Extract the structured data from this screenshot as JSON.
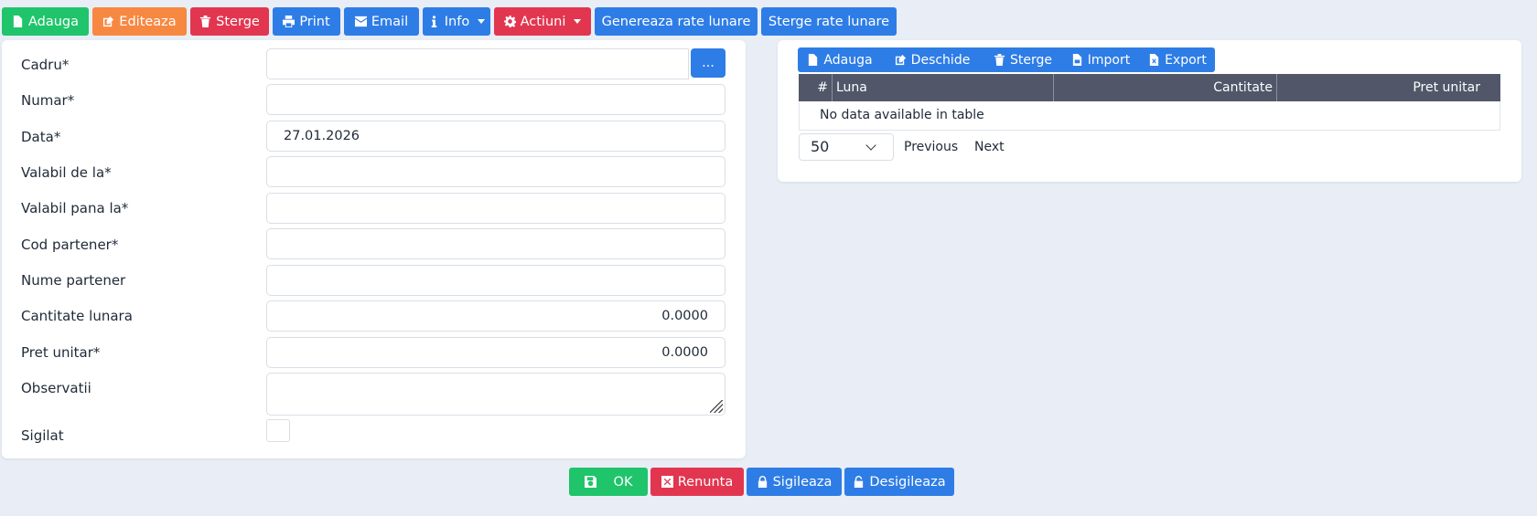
{
  "toolbar": {
    "add": "Adauga",
    "edit": "Editeaza",
    "delete": "Sterge",
    "print": "Print",
    "email": "Email",
    "info": "Info",
    "actions": "Actiuni",
    "generate": "Genereaza rate lunare",
    "delete_rates": "Sterge rate lunare"
  },
  "form": {
    "cadru_label": "Cadru*",
    "cadru_button": "...",
    "numar_label": "Numar*",
    "data_label": "Data*",
    "data_value": "27.01.2026",
    "valabil_de_la_label": "Valabil de la*",
    "valabil_pana_la_label": "Valabil pana la*",
    "cod_partener_label": "Cod partener*",
    "nume_partener_label": "Nume partener",
    "cantitate_label": "Cantitate lunara",
    "cantitate_value": "0.0000",
    "pret_label": "Pret unitar*",
    "pret_value": "0.0000",
    "observatii_label": "Observatii",
    "sigilat_label": "Sigilat"
  },
  "grid": {
    "add": "Adauga",
    "open": "Deschide",
    "delete": "Sterge",
    "import": "Import",
    "export": "Export",
    "columns": [
      "#",
      "Luna",
      "Cantitate",
      "Pret unitar"
    ],
    "empty_message": "No data available in table",
    "page_size": "50",
    "previous": "Previous",
    "next": "Next"
  },
  "footer": {
    "ok": "OK",
    "cancel": "Renunta",
    "seal": "Sigileaza",
    "unseal": "Desigileaza"
  },
  "colors": {
    "green": "#1fc46b",
    "orange": "#f78842",
    "red": "#e23650",
    "blue": "#2e7de6",
    "table_header": "#515769",
    "background": "#e9eef6"
  }
}
